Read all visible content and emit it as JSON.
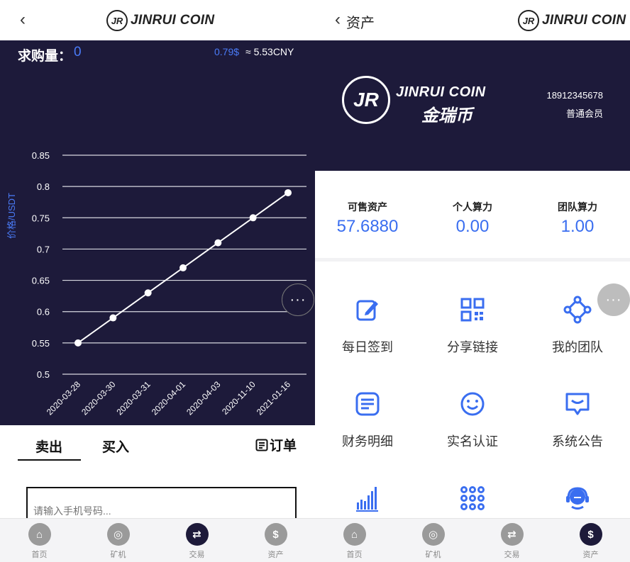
{
  "left": {
    "header": {
      "back_glyph": "‹",
      "logo_badge": "JR",
      "logo_text": "JINRUI COIN"
    },
    "purchase": {
      "label": "求购量：",
      "value": "0",
      "price_usd": "0.79$",
      "price_cny": "≈  5.53CNY"
    },
    "chart_data": {
      "type": "line",
      "ylabel": "价格/USDT",
      "ylim": [
        0.5,
        0.85
      ],
      "y_ticks": [
        "0.85",
        "0.8",
        "0.75",
        "0.7",
        "0.65",
        "0.6",
        "0.55",
        "0.5"
      ],
      "categories": [
        "2020-03-28",
        "2020-03-30",
        "2020-03-31",
        "2020-04-01",
        "2020-04-03",
        "2020-11-10",
        "2021-01-16"
      ],
      "values": [
        0.55,
        0.59,
        0.63,
        0.67,
        0.71,
        0.75,
        0.79
      ],
      "grid": true,
      "line_color": "#ffffff"
    },
    "more_glyph": "···",
    "tabs": {
      "sell": "卖出",
      "buy": "买入",
      "orders": "订单",
      "orders_icon": "list-icon"
    },
    "phone_placeholder": "请输入手机号码...",
    "nav": [
      {
        "label": "首页",
        "icon": "home-icon",
        "glyph": "⌂"
      },
      {
        "label": "矿机",
        "icon": "miner-icon",
        "glyph": "◎"
      },
      {
        "label": "交易",
        "icon": "handshake-icon",
        "glyph": "⇄",
        "active": true
      },
      {
        "label": "资产",
        "icon": "dollar-icon",
        "glyph": "$"
      }
    ]
  },
  "right": {
    "header": {
      "back_glyph": "‹",
      "title": "资产",
      "logo_badge": "JR",
      "logo_text": "JINRUI COIN"
    },
    "profile": {
      "logo_badge": "JR",
      "brand": "JINRUI COIN",
      "brand_cn": "金瑞币",
      "phone": "18912345678",
      "level": "普通会员"
    },
    "stats": [
      {
        "label": "可售资产",
        "value": "57.6880"
      },
      {
        "label": "个人算力",
        "value": "0.00"
      },
      {
        "label": "团队算力",
        "value": "1.00"
      }
    ],
    "grid": [
      {
        "label": "每日签到",
        "icon": "edit-icon"
      },
      {
        "label": "分享链接",
        "icon": "qr-code-icon"
      },
      {
        "label": "我的团队",
        "icon": "team-icon"
      },
      {
        "label": "财务明细",
        "icon": "document-icon"
      },
      {
        "label": "实名认证",
        "icon": "smile-icon"
      },
      {
        "label": "系统公告",
        "icon": "announcement-icon"
      },
      {
        "label": "",
        "icon": "bar-chart-icon"
      },
      {
        "label": "",
        "icon": "apps-grid-icon"
      },
      {
        "label": "",
        "icon": "customer-service-icon"
      }
    ],
    "more_glyph": "···",
    "nav": [
      {
        "label": "首页",
        "icon": "home-icon",
        "glyph": "⌂"
      },
      {
        "label": "矿机",
        "icon": "miner-icon",
        "glyph": "◎"
      },
      {
        "label": "交易",
        "icon": "handshake-icon",
        "glyph": "⇄"
      },
      {
        "label": "资产",
        "icon": "dollar-icon",
        "glyph": "$",
        "active": true
      }
    ]
  },
  "colors": {
    "dark": "#1d1a3a",
    "accent": "#3a6ef0",
    "nav_bg": "#f4f4f6"
  }
}
